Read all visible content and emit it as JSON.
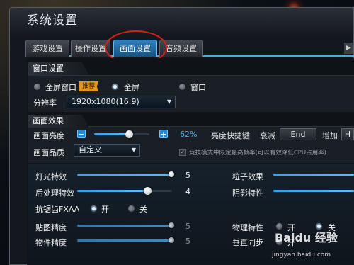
{
  "window": {
    "title": "系统设置"
  },
  "tabs": [
    {
      "label": "游戏设置",
      "active": false
    },
    {
      "label": "操作设置",
      "active": false
    },
    {
      "label": "画面设置",
      "active": true
    },
    {
      "label": "音频设置",
      "active": false
    }
  ],
  "tab_scroll": "▶",
  "window_settings": {
    "title": "窗口设置",
    "modes": [
      {
        "label": "全屏窗口",
        "selected": false
      },
      {
        "label": "全屏",
        "selected": true
      },
      {
        "label": "窗口",
        "selected": false
      }
    ],
    "recommend_badge": "推荐",
    "resolution_label": "分辨率",
    "resolution_value": "1920x1080(16:9)"
  },
  "effects": {
    "title": "画面效果",
    "brightness_label": "画面亮度",
    "brightness_minus": "−",
    "brightness_plus": "+",
    "brightness_value": "62%",
    "brightness_fraction": 0.62,
    "hotkey_label": "亮度快捷键",
    "decrease_label": "衰减",
    "decrease_key": "End",
    "increase_label": "增加",
    "increase_key": "H",
    "quality_label": "画面品质",
    "quality_value": "自定义",
    "competitive_note": "竞技模式中限定最高帧率(可以有效降低CPU占用率)"
  },
  "advanced": {
    "light_label": "灯光特效",
    "light_value": "5",
    "light_fraction": 1.0,
    "post_label": "后处理特效",
    "post_value": "4",
    "post_fraction": 0.75,
    "aa_label": "抗锯齿FXAA",
    "aa_on": "开",
    "aa_off": "关",
    "texture_label": "贴图精度",
    "texture_value": "5",
    "object_label": "物件精度",
    "object_value": "5",
    "particle_label": "粒子效果",
    "shadow_label": "阴影特性",
    "physics_label": "物理特性",
    "physics_on": "开",
    "physics_off": "关",
    "vsync_label": "垂直同步",
    "vsync_on": "开"
  },
  "watermark": {
    "logo": "Baidu 经验",
    "url": "jingyan.baidu.com"
  },
  "colors": {
    "accent": "#2e8fd8",
    "highlight_circle": "#d4201c",
    "badge": "#e39518"
  }
}
